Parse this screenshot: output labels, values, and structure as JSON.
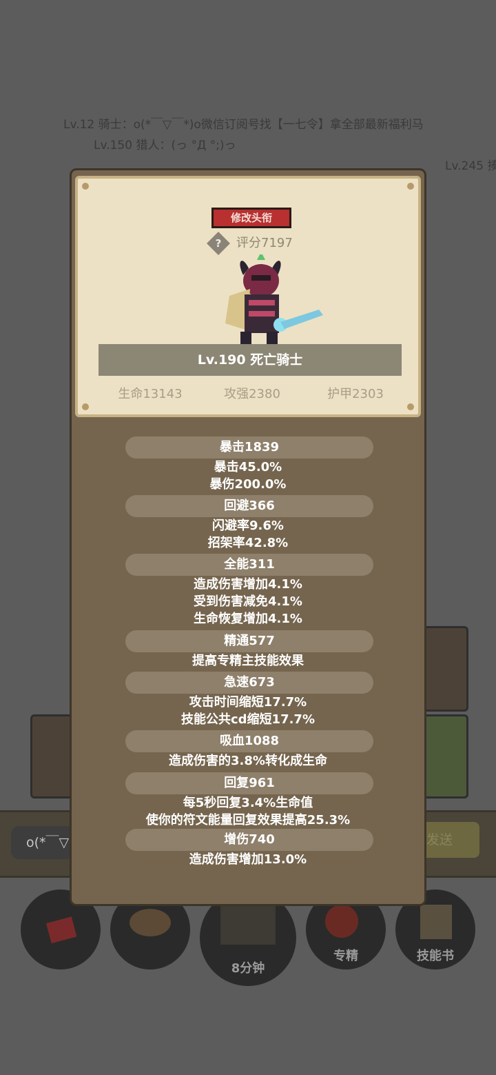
{
  "chat": {
    "line1": "Lv.12 骑士：o(*￣▽￣*)o微信订阅号找【一七令】拿全部最新福利马",
    "line2": "Lv.150 猎人：(っ °Д °;)っ",
    "line3": "Lv.245 揍"
  },
  "bottom": {
    "input_value": "o(*￣▽",
    "send_label": "发送",
    "timer_label": "8分钟",
    "specialize_label": "专精",
    "skillbook_label": "技能书"
  },
  "panel": {
    "edit_title_label": "修改头衔",
    "help_icon_glyph": "?",
    "score": "评分7197",
    "name": "Lv.190 死亡骑士",
    "hp": "生命13143",
    "attack": "攻强2380",
    "armor": "护甲2303"
  },
  "attributes": [
    {
      "header": "暴击1839",
      "lines": [
        "暴击45.0%",
        "暴伤200.0%"
      ]
    },
    {
      "header": "回避366",
      "lines": [
        "闪避率9.6%",
        "招架率42.8%"
      ]
    },
    {
      "header": "全能311",
      "lines": [
        "造成伤害增加4.1%",
        "受到伤害减免4.1%",
        "生命恢复增加4.1%"
      ]
    },
    {
      "header": "精通577",
      "lines": [
        "提高专精主技能效果"
      ]
    },
    {
      "header": "急速673",
      "lines": [
        "攻击时间缩短17.7%",
        "技能公共cd缩短17.7%"
      ]
    },
    {
      "header": "吸血1088",
      "lines": [
        "造成伤害的3.8%转化成生命"
      ]
    },
    {
      "header": "回复961",
      "lines": [
        "每5秒回复3.4%生命值",
        "使你的符文能量回复效果提高25.3%"
      ]
    },
    {
      "header": "增伤740",
      "lines": [
        "造成伤害增加13.0%"
      ]
    }
  ],
  "colors": {
    "overlay": "#5c5c5c",
    "panel": "#75654e",
    "parchment": "#ece1c4",
    "title_button": "#b83030"
  }
}
